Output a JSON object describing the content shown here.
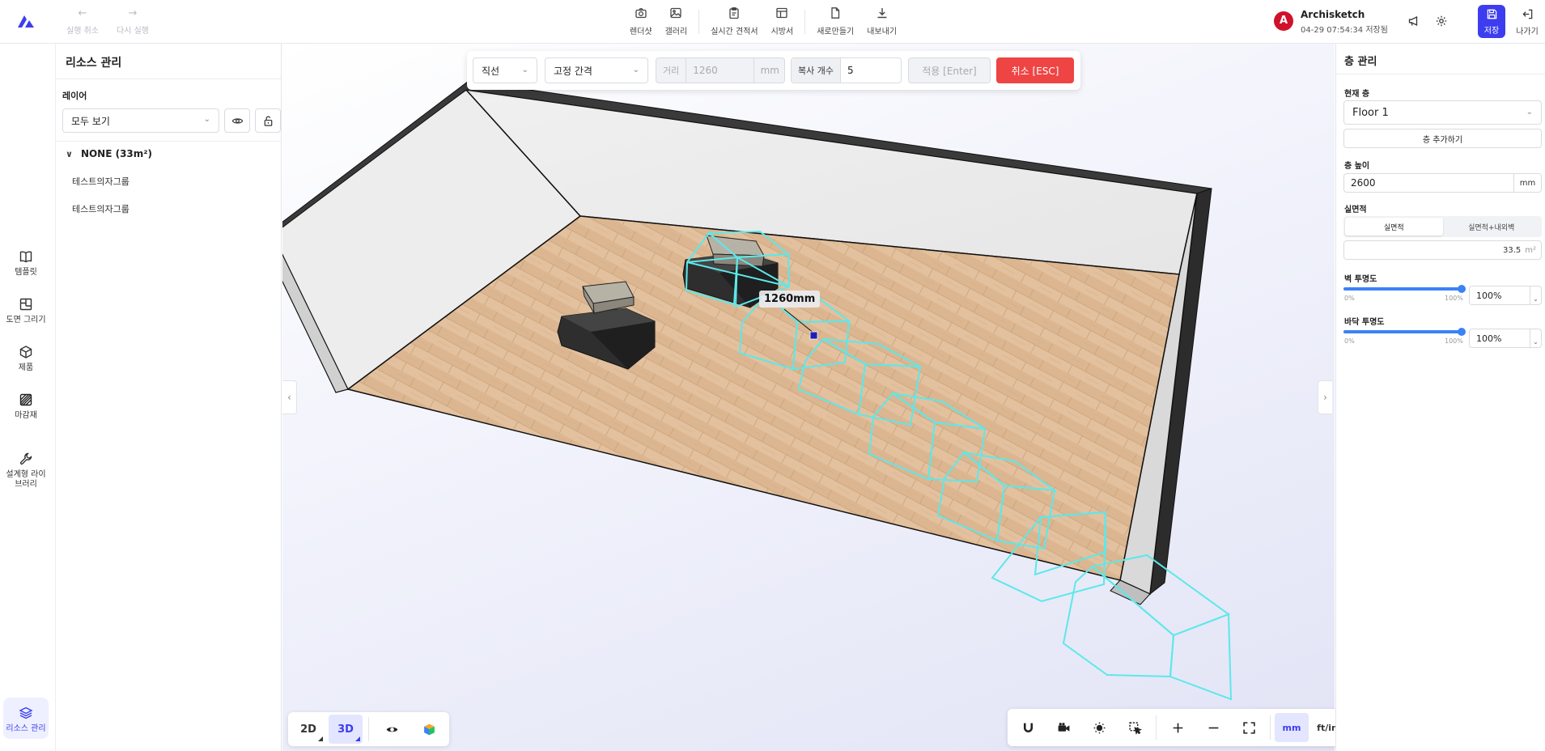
{
  "topbar": {
    "undo_label": "실행 취소",
    "redo_label": "다시 실행",
    "tools": [
      {
        "label": "렌더샷",
        "icon": "camera-icon"
      },
      {
        "label": "갤러리",
        "icon": "gallery-icon"
      },
      {
        "label": "실시간 견적서",
        "icon": "clipboard-icon"
      },
      {
        "label": "시방서",
        "icon": "spec-table-icon"
      },
      {
        "label": "새로만들기",
        "icon": "new-file-icon"
      },
      {
        "label": "내보내기",
        "icon": "download-icon"
      }
    ],
    "user": {
      "initial": "A",
      "name": "Archisketch",
      "saved_status": "04-29 07:54:34 저장됨"
    },
    "save_label": "저장",
    "exit_label": "나가기"
  },
  "leftnav": {
    "items": [
      {
        "label": "템플릿",
        "icon": "book-icon"
      },
      {
        "label": "도면 그리기",
        "icon": "floorplan-icon"
      },
      {
        "label": "제품",
        "icon": "cube-icon"
      },
      {
        "label": "마감재",
        "icon": "hatch-icon"
      },
      {
        "label": "설계형 라이브러리",
        "icon": "wrench-icon"
      }
    ],
    "active_item": {
      "label": "리소스 관리",
      "icon": "layers-icon"
    }
  },
  "resources": {
    "title": "리소스 관리",
    "layer_label": "레이어",
    "layer_select_value": "모두 보기",
    "group_name": "NONE (33m²)",
    "items": [
      "테스트의자그룹",
      "테스트의자그룹"
    ]
  },
  "copybar": {
    "mode_value": "직선",
    "spacing_value": "고정 간격",
    "distance_label": "거리",
    "distance_value": "1260",
    "distance_unit": "mm",
    "count_label": "복사 개수",
    "count_value": "5",
    "apply_label": "적용 [Enter]",
    "cancel_label": "취소 [ESC]"
  },
  "viewport": {
    "measure_label": "1260mm",
    "view_2d": "2D",
    "view_3d": "3D",
    "unit_mm": "mm",
    "unit_ftin": "ft/in"
  },
  "floor": {
    "title": "층 관리",
    "current_floor_label": "현재 층",
    "current_floor_value": "Floor 1",
    "add_floor_label": "층 추가하기",
    "height_label": "층 높이",
    "height_value": "2600",
    "height_unit": "mm",
    "area_label": "실면적",
    "area_tabs": [
      "실면적",
      "실면적+내외벽"
    ],
    "area_value": "33.5",
    "area_unit": "m²",
    "wall_opacity_label": "벽 투명도",
    "wall_opacity_min": "0%",
    "wall_opacity_max": "100%",
    "wall_opacity_value": "100%",
    "wall_opacity_level": 1.0,
    "floor_opacity_label": "바닥 투명도",
    "floor_opacity_min": "0%",
    "floor_opacity_max": "100%",
    "floor_opacity_value": "100%",
    "floor_opacity_level": 1.0
  },
  "colors": {
    "accent": "#3d3df0",
    "cancel": "#ef4444",
    "selection": "#5ce8ea",
    "slider": "#3b82f6"
  }
}
